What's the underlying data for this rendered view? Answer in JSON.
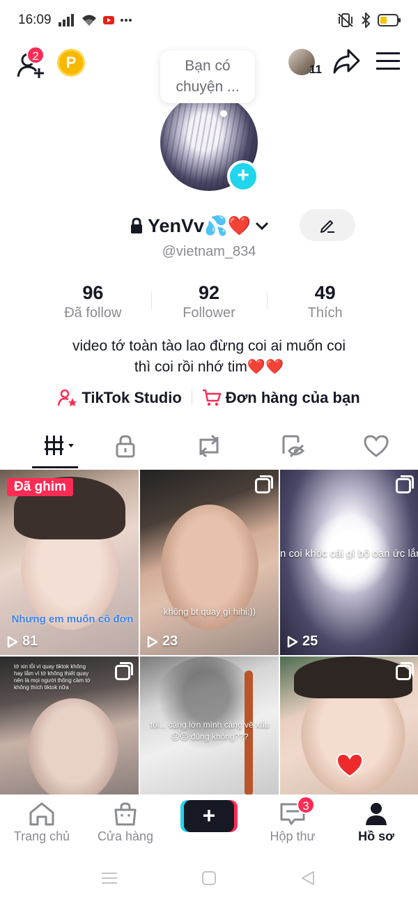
{
  "status_bar": {
    "time": "16:09",
    "left_icons": [
      "signal-icon",
      "wifi-icon",
      "youtube-icon",
      "more-dots-icon"
    ],
    "right_icons": [
      "vibrate-icon",
      "bluetooth-icon",
      "battery-icon"
    ]
  },
  "top_bar": {
    "add_friend_badge": "2",
    "coin_label": "P",
    "friends_count": "11",
    "share_icon": "share-arrow-icon",
    "menu_icon": "hamburger-menu-icon"
  },
  "bubble": {
    "line1": "Bạn có",
    "line2": "chuyện ..."
  },
  "profile": {
    "display_name": "YenVv💦❤️",
    "username": "@vietnam_834",
    "avatar_plus": "+"
  },
  "stats": [
    {
      "value": "96",
      "label": "Đã follow"
    },
    {
      "value": "92",
      "label": "Follower"
    },
    {
      "value": "49",
      "label": "Thích"
    }
  ],
  "bio": {
    "line1": "video tớ toàn tào lao đừng coi ai muốn coi",
    "line2": "thì coi rồi nhớ tim❤️❤️"
  },
  "links": {
    "studio": "TikTok Studio",
    "orders": "Đơn hàng của bạn"
  },
  "tabs": [
    "videos-grid-icon",
    "lock-icon",
    "repost-icon",
    "hidden-eye-icon",
    "heart-icon"
  ],
  "videos": [
    {
      "pinned_label": "Đã ghim",
      "views": "81",
      "caption": "Nhưng em muốn cô đơn"
    },
    {
      "views": "23",
      "caption": "không bt quay gì hihi:))"
    },
    {
      "views": "25",
      "caption": "n coi khóc cái gì bộ oan ức lắm h"
    },
    {
      "caption": "tớ xin lỗi vì quay tiktok không hay lắm vì tớ không thiết quay nên là mọi người thông cảm tớ không thích tiktok nữa"
    },
    {
      "caption": "tôi... càng lớn mình càng vẽ xấu😣😣 đúng không???"
    },
    {
      "caption": ""
    }
  ],
  "bottom_nav": {
    "home": "Trang chủ",
    "shop": "Cửa hàng",
    "create": "+",
    "inbox": "Hộp thư",
    "inbox_badge": "3",
    "profile": "Hồ sơ"
  },
  "colors": {
    "accent_red": "#fe2c55",
    "accent_cyan": "#20d5ec",
    "text_primary": "#161823",
    "text_secondary": "#8a8b91"
  }
}
